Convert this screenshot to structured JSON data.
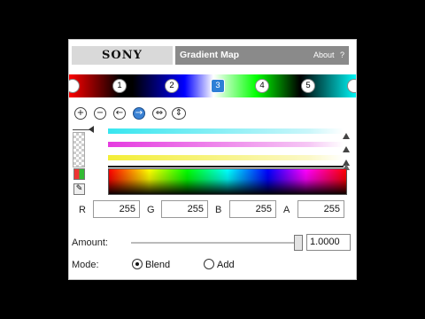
{
  "header": {
    "logo": "SONY",
    "title": "Gradient Map",
    "about": "About",
    "help": "?"
  },
  "gradient": {
    "stops": [
      "1",
      "2",
      "3",
      "4",
      "5"
    ],
    "selected_stop": "3",
    "colors": [
      "#ff0000",
      "#000000",
      "#0000ff",
      "#ffffff",
      "#00ff00",
      "#000000",
      "#00ffff"
    ]
  },
  "toolbar": {
    "add_icon": "+",
    "remove_icon": "−",
    "prev_icon": "←",
    "next_icon": "→",
    "expand_icon": "⇔",
    "contract_icon": "⇕"
  },
  "channels": {
    "bars": [
      "cyan",
      "magenta",
      "yellow"
    ],
    "colors": {
      "cyan": "#38e6ef",
      "magenta": "#e53be0",
      "yellow": "#f3ee36",
      "black": "#111111"
    }
  },
  "color": {
    "r_label": "R",
    "r": "255",
    "g_label": "G",
    "g": "255",
    "b_label": "B",
    "b": "255",
    "a_label": "A",
    "a": "255"
  },
  "amount": {
    "label": "Amount:",
    "value": "1.0000",
    "level": 1.0
  },
  "mode": {
    "label": "Mode:",
    "blend": "Blend",
    "add": "Add",
    "selected": "Blend"
  },
  "icons": {
    "eyedropper": "eyedropper-icon",
    "palette": "palette-icon",
    "alpha": "alpha-checker-icon"
  }
}
